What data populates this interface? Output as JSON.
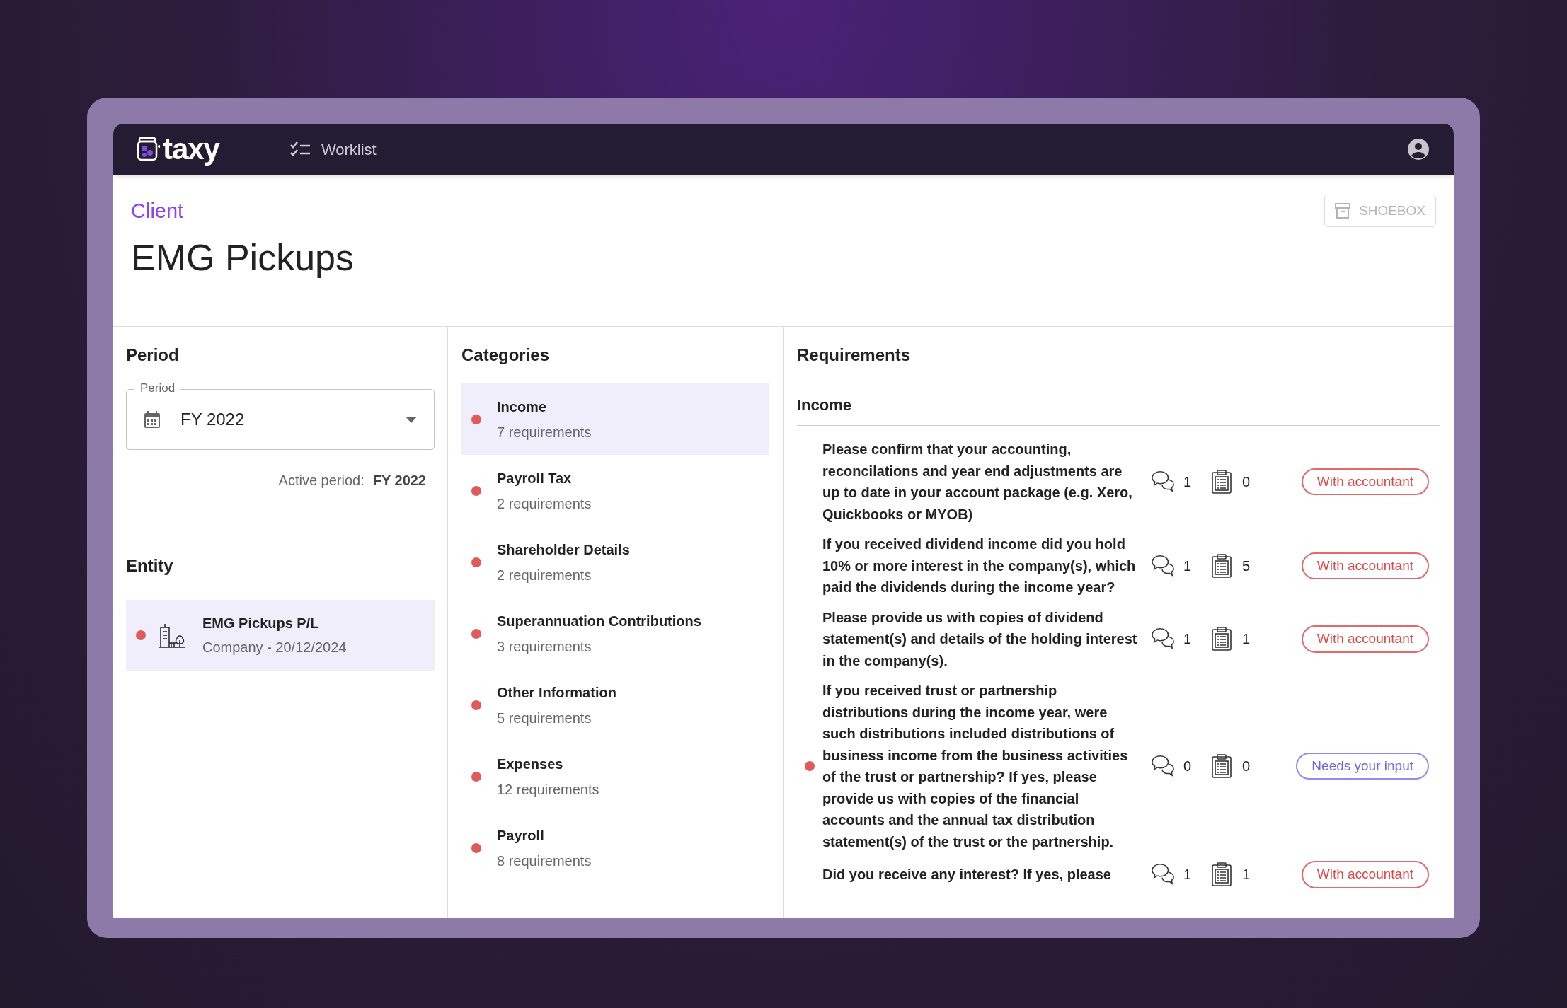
{
  "nav": {
    "logo": "taxy",
    "items": [
      {
        "label": "Worklist",
        "selected": false
      }
    ]
  },
  "header": {
    "eyebrow": "Client",
    "title": "EMG Pickups",
    "shoebox_button": "SHOEBOX"
  },
  "period": {
    "heading": "Period",
    "field_label": "Period",
    "value": "FY 2022",
    "active_label": "Active period:",
    "active_value": "FY 2022"
  },
  "entity": {
    "heading": "Entity",
    "items": [
      {
        "name": "EMG Pickups P/L",
        "detail": "Company - 20/12/2024",
        "selected": true,
        "color": "#e05a5a"
      }
    ]
  },
  "categories": {
    "heading": "Categories",
    "items": [
      {
        "name": "Income",
        "count": "7 requirements",
        "selected": true,
        "color": "#e05a5a"
      },
      {
        "name": "Payroll Tax",
        "count": "2 requirements",
        "selected": false,
        "color": "#e05a5a"
      },
      {
        "name": "Shareholder Details",
        "count": "2 requirements",
        "selected": false,
        "color": "#e05a5a"
      },
      {
        "name": "Superannuation Contributions",
        "count": "3 requirements",
        "selected": false,
        "color": "#e05a5a"
      },
      {
        "name": "Other Information",
        "count": "5 requirements",
        "selected": false,
        "color": "#e05a5a"
      },
      {
        "name": "Expenses",
        "count": "12 requirements",
        "selected": false,
        "color": "#e05a5a"
      },
      {
        "name": "Payroll",
        "count": "8 requirements",
        "selected": false,
        "color": "#e05a5a"
      }
    ]
  },
  "requirements": {
    "heading": "Requirements",
    "section": "Income",
    "items": [
      {
        "text": "Please confirm that your accounting, reconcilations and year end adjustments are up to date in your account package (e.g. Xero, Quickbooks or MYOB)",
        "flagged": false,
        "comments": "1",
        "documents": "0",
        "status": "With accountant",
        "kind": "accountant"
      },
      {
        "text": "If you received dividend income did you hold 10% or more interest in the company(s), which paid the dividends during the income year?",
        "flagged": false,
        "comments": "1",
        "documents": "5",
        "status": "With accountant",
        "kind": "accountant"
      },
      {
        "text": "Please provide us with copies of dividend statement(s) and details of the holding interest in the company(s).",
        "flagged": false,
        "comments": "1",
        "documents": "1",
        "status": "With accountant",
        "kind": "accountant"
      },
      {
        "text": "If you received trust or partnership distributions during the income year, were such distributions included distributions of business income from the business activities of the trust or partnership? If yes, please provide us with copies of the financial accounts and the annual tax distribution statement(s) of the trust or the partnership.",
        "flagged": true,
        "comments": "0",
        "documents": "0",
        "status": "Needs your input",
        "kind": "input"
      },
      {
        "text": "Did you receive any interest? If yes, please",
        "flagged": false,
        "comments": "1",
        "documents": "1",
        "status": "With accountant",
        "kind": "accountant"
      }
    ]
  }
}
